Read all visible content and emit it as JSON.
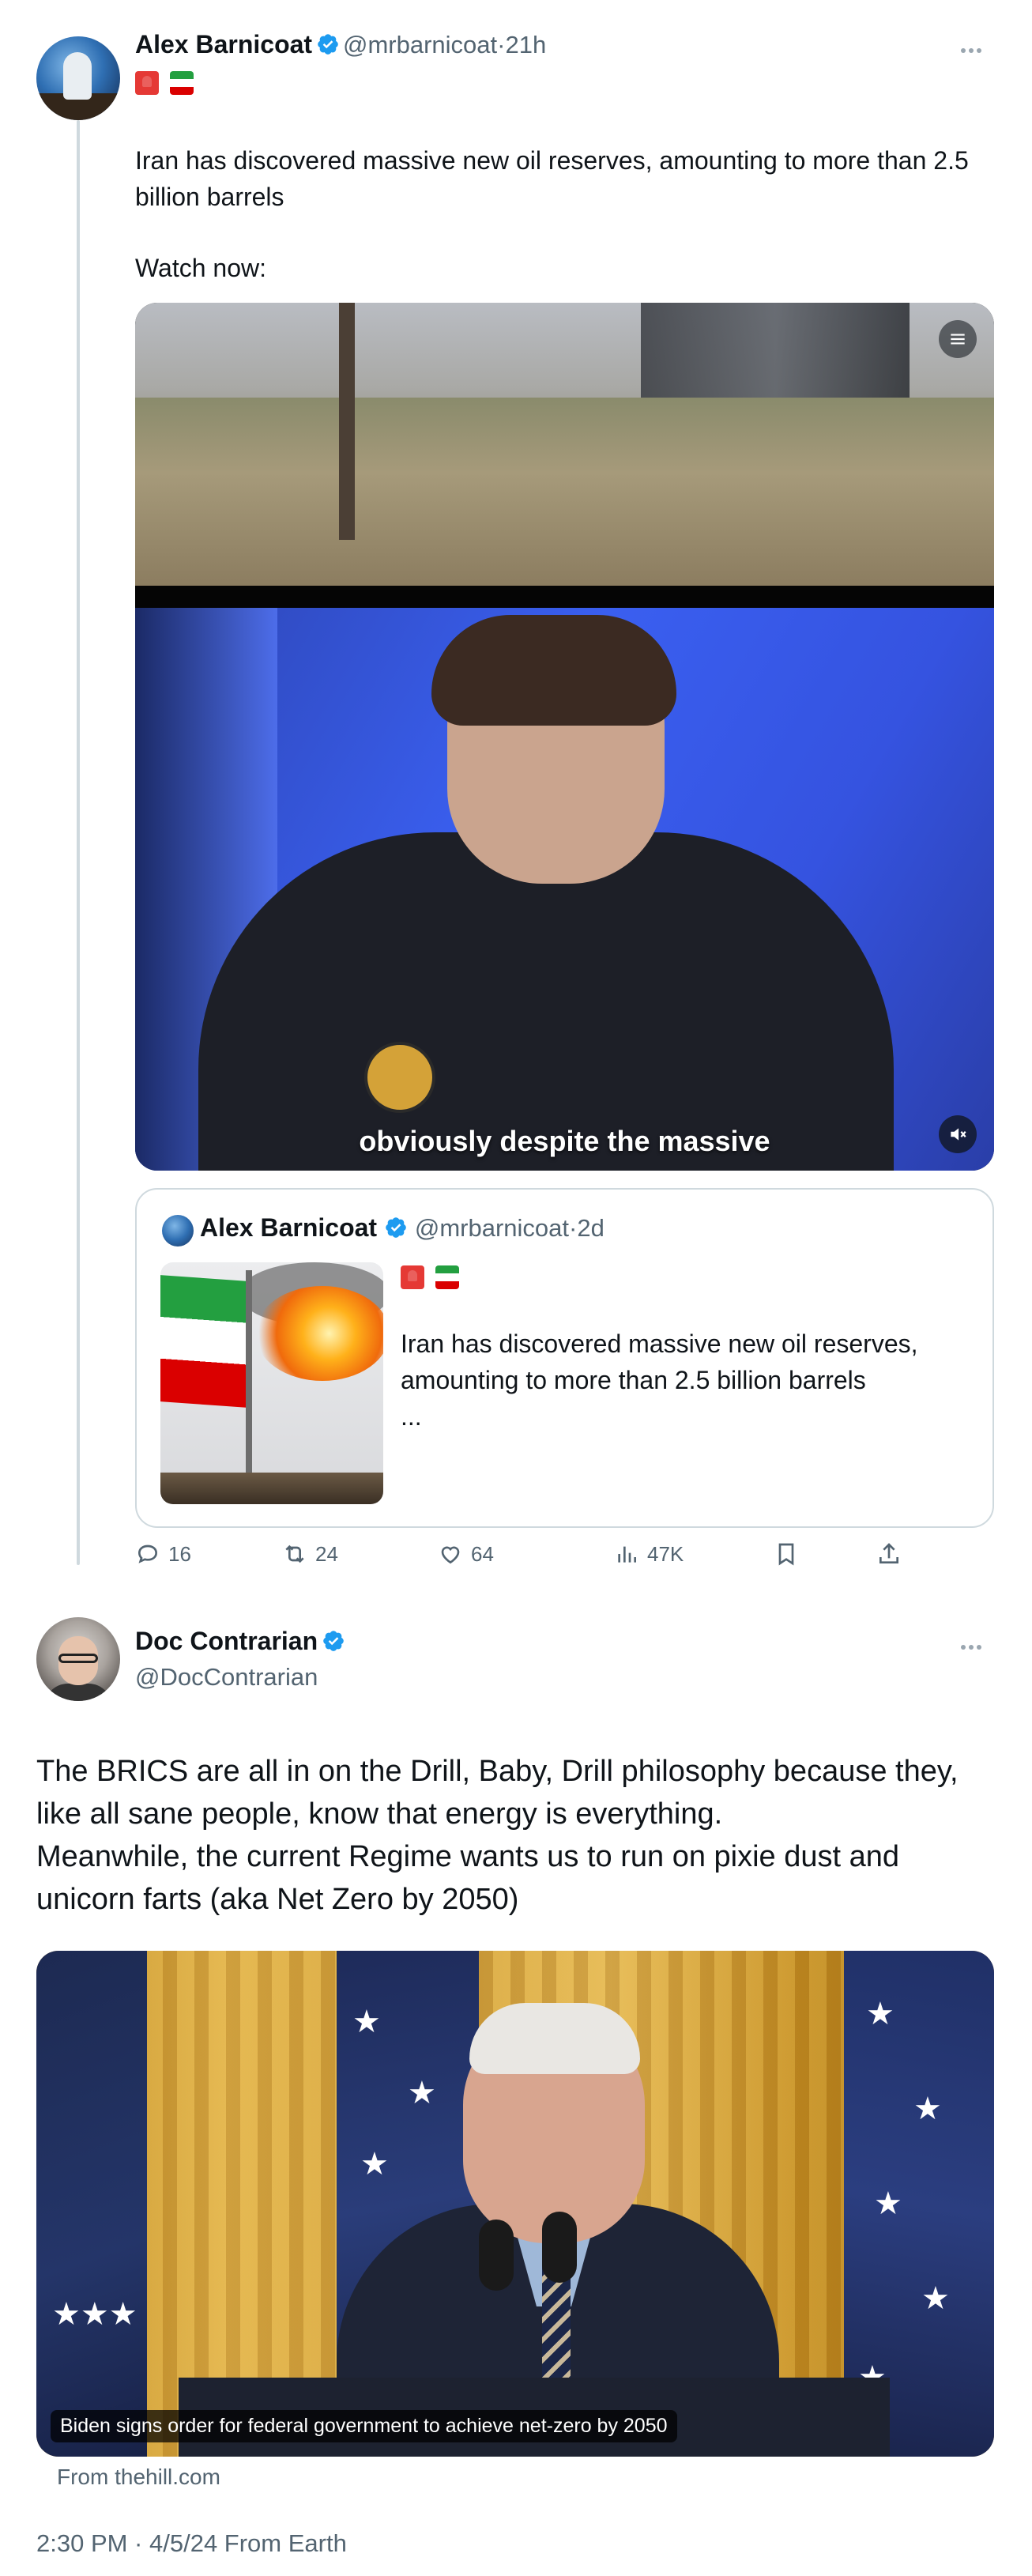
{
  "tweet1": {
    "author_name": "Alex Barnicoat",
    "handle": "@mrbarnicoat",
    "time": "21h",
    "emojis": [
      "siren",
      "iran-flag"
    ],
    "text": "Iran has discovered massive new oil reserves, amounting to more than 2.5 billion barrels",
    "text2": "Watch now:",
    "video": {
      "caption": "obviously despite the massive"
    },
    "quote": {
      "author_name": "Alex Barnicoat",
      "handle": "@mrbarnicoat",
      "time": "2d",
      "emojis": [
        "siren",
        "iran-flag"
      ],
      "text": "Iran has discovered massive new oil reserves, amounting to more than 2.5 billion barrels",
      "ellipsis": "..."
    },
    "actions": {
      "replies": "16",
      "reposts": "24",
      "likes": "64",
      "views": "47K"
    }
  },
  "tweet2": {
    "author_name": "Doc Contrarian",
    "handle": "@DocContrarian",
    "text_line1": "The BRICS are all in on the Drill, Baby, Drill philosophy because they, like all sane people, know that energy is everything.",
    "text_line2": "Meanwhile, the current Regime wants us to run on pixie dust and unicorn farts (aka Net Zero by 2050)",
    "media_caption": "Biden signs order for federal government to achieve net-zero by 2050",
    "source": "From thehill.com",
    "timestamp": "2:30 PM · 4/5/24 From Earth"
  },
  "colors": {
    "text_primary": "#0f1419",
    "text_secondary": "#536471",
    "verified_blue": "#1d9bf0",
    "border": "#cfd9de"
  },
  "icons": {
    "verified": "verified-badge-icon",
    "more": "more-dots-icon",
    "reply": "reply-icon",
    "repost": "repost-icon",
    "like": "heart-icon",
    "views": "views-icon",
    "bookmark": "bookmark-icon",
    "share": "share-icon",
    "mute": "mute-icon",
    "settings": "settings-icon"
  }
}
